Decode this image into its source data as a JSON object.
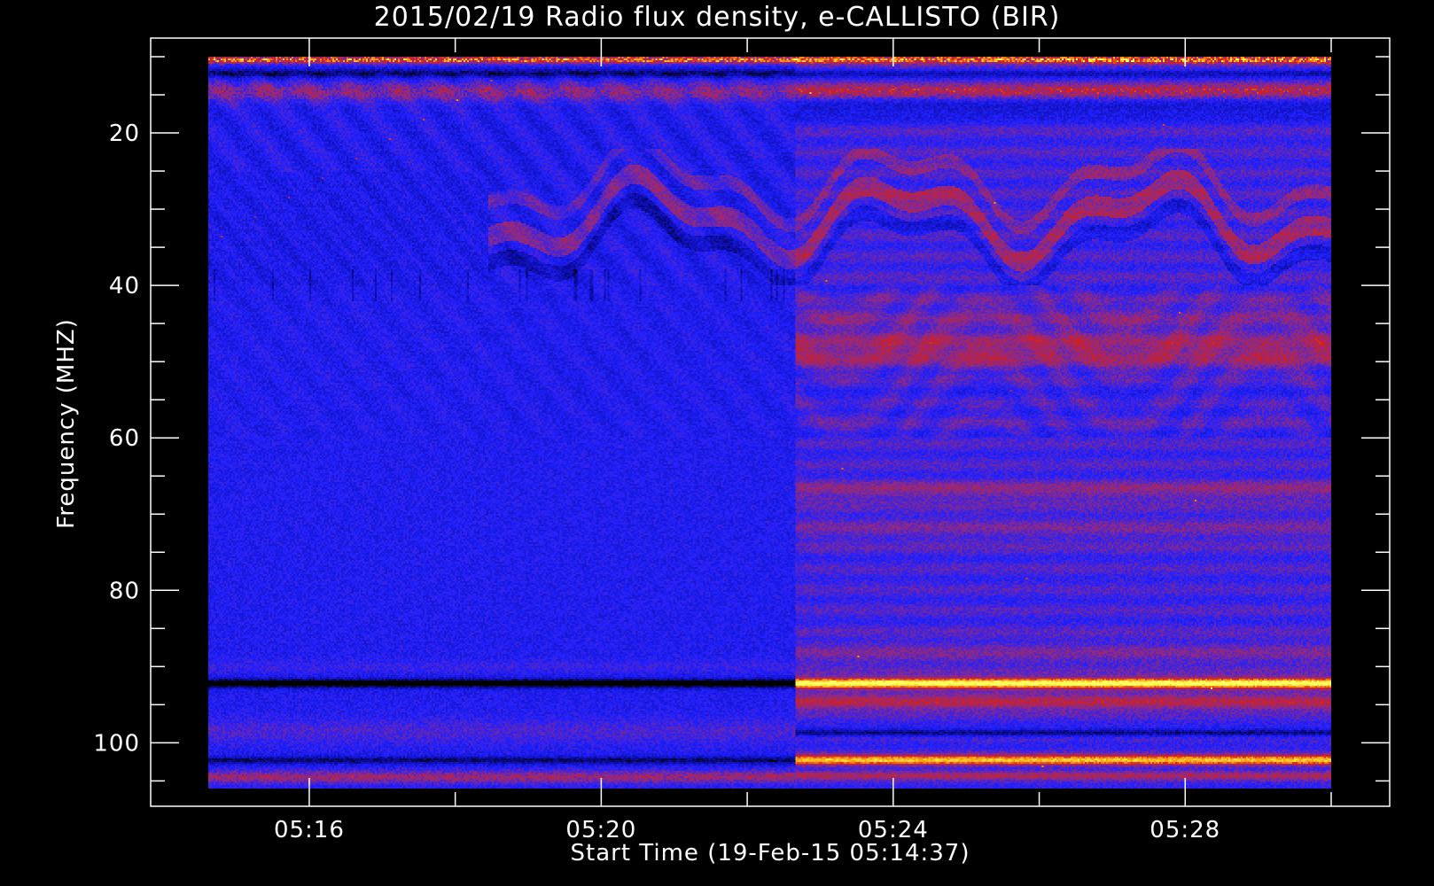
{
  "chart_data": {
    "type": "heatmap",
    "title": "2015/02/19  Radio flux density, e-CALLISTO (BIR)",
    "xlabel": "Start Time (19-Feb-15 05:14:37)",
    "ylabel": "Frequency (MHZ)",
    "x_range": [
      "05:14:37",
      "05:30:00"
    ],
    "x_ticks": [
      "05:16",
      "05:20",
      "05:24",
      "05:28"
    ],
    "y_range": [
      10,
      106
    ],
    "y_axis_inverted": true,
    "y_ticks": [
      20,
      40,
      60,
      80,
      100
    ],
    "y_tick_labels": [
      "20",
      "40",
      "60",
      "80",
      "100"
    ],
    "regime_change_time": "05:22:40",
    "colormap": [
      "#000000",
      "#0a0a9a",
      "#2020ff",
      "#8a2a8a",
      "#d02020",
      "#ff9a10",
      "#ffff60"
    ],
    "features": [
      {
        "name": "rfi-band",
        "freq_mhz": 92.2,
        "after_change": "bright yellow",
        "before_change": "dark"
      },
      {
        "name": "rfi-band",
        "freq_mhz": 102.3,
        "after_change": "bright orange",
        "before_change": "dark"
      },
      {
        "name": "rfi-band",
        "freq_mhz": 94.7,
        "after_change": "red"
      },
      {
        "name": "dark-band",
        "freq_mhz": 98.7
      },
      {
        "name": "noisy-edge",
        "freq_mhz": 10.3,
        "color": "red-orange"
      },
      {
        "name": "noisy-edge",
        "freq_mhz": 14.5,
        "color": "red"
      },
      {
        "name": "red-band",
        "freq_mhz": 48.5,
        "after_change": "red"
      },
      {
        "name": "red-band",
        "freq_mhz": 67.0,
        "after_change": "red"
      },
      {
        "name": "wave-pattern",
        "freq_range_mhz": [
          27,
          39
        ],
        "color": "purple-red"
      }
    ]
  }
}
